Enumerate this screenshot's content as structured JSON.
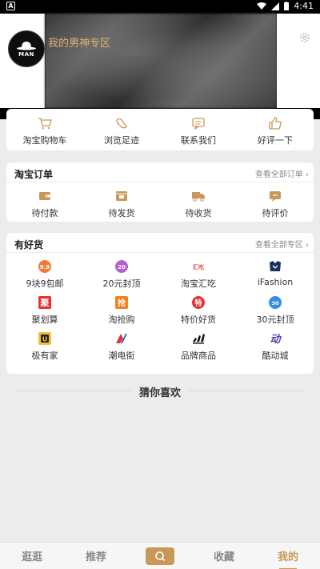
{
  "status_bar": {
    "time": "4:41",
    "left_icon": "A"
  },
  "header": {
    "title": "我的男神专区",
    "avatar_text": "MAN"
  },
  "quick_actions": [
    {
      "label": "淘宝购物车",
      "icon": "cart-icon"
    },
    {
      "label": "浏览足迹",
      "icon": "footprint-icon"
    },
    {
      "label": "联系我们",
      "icon": "chat-icon"
    },
    {
      "label": "好评一下",
      "icon": "thumbs-up-icon"
    }
  ],
  "orders": {
    "title": "淘宝订单",
    "more": "查看全部订单",
    "items": [
      {
        "label": "待付款",
        "icon": "wallet-icon"
      },
      {
        "label": "待发货",
        "icon": "package-icon"
      },
      {
        "label": "待收货",
        "icon": "truck-icon"
      },
      {
        "label": "待评价",
        "icon": "comment-icon"
      }
    ]
  },
  "goods": {
    "title": "有好货",
    "more": "查看全部专区",
    "items": [
      {
        "label": "9块9包邮",
        "icon": "99-icon",
        "badge": "9.9"
      },
      {
        "label": "20元封顶",
        "icon": "20-icon",
        "badge": "20"
      },
      {
        "label": "淘宝汇吃",
        "icon": "huichi-icon",
        "badge": "汇吃"
      },
      {
        "label": "iFashion",
        "icon": "ifashion-icon",
        "badge": ""
      },
      {
        "label": "聚划算",
        "icon": "juhuasuan-icon",
        "badge": "聚"
      },
      {
        "label": "淘抢购",
        "icon": "qianggou-icon",
        "badge": "抢"
      },
      {
        "label": "特价好货",
        "icon": "tejia-icon",
        "badge": "特"
      },
      {
        "label": "30元封顶",
        "icon": "30-icon",
        "badge": "30"
      },
      {
        "label": "极有家",
        "icon": "jiyoujia-icon",
        "badge": "U"
      },
      {
        "label": "潮电街",
        "icon": "chaodian-icon",
        "badge": ""
      },
      {
        "label": "品牌商品",
        "icon": "adidas-icon",
        "badge": ""
      },
      {
        "label": "酷动城",
        "icon": "kudong-icon",
        "badge": "动"
      }
    ]
  },
  "guess": "猜你喜欢",
  "tabs": [
    {
      "label": "逛逛",
      "active": false
    },
    {
      "label": "推荐",
      "active": false
    },
    {
      "label": "",
      "active": false,
      "icon": "search-icon"
    },
    {
      "label": "收藏",
      "active": false
    },
    {
      "label": "我的",
      "active": true
    }
  ],
  "colors": {
    "accent": "#c8985a",
    "title": "#e0b070"
  }
}
